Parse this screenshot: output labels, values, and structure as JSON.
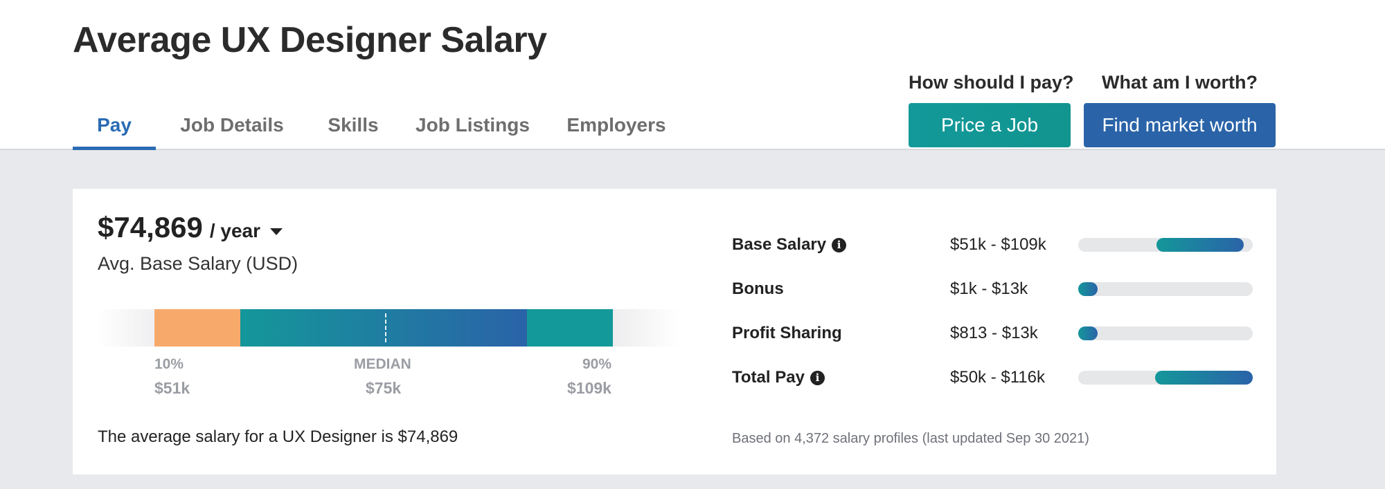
{
  "header": {
    "title": "Average UX Designer Salary",
    "tabs": [
      {
        "label": "Pay",
        "active": true
      },
      {
        "label": "Job Details",
        "active": false
      },
      {
        "label": "Skills",
        "active": false
      },
      {
        "label": "Job Listings",
        "active": false
      },
      {
        "label": "Employers",
        "active": false
      }
    ],
    "cta_employer": {
      "question": "How should I pay?",
      "button": "Price a Job",
      "color": "#14999a"
    },
    "cta_worker": {
      "question": "What am I worth?",
      "button": "Find market worth",
      "color": "#2a63a8"
    }
  },
  "salary": {
    "amount": "$74,869",
    "period": "/ year",
    "label": "Avg. Base Salary (USD)",
    "distribution": {
      "low_label": "10%",
      "low_value": "$51k",
      "median_label": "MEDIAN",
      "median_value": "$75k",
      "high_label": "90%",
      "high_value": "$109k"
    },
    "summary": "The average salary for a UX Designer is $74,869"
  },
  "pay_breakdown": [
    {
      "label": "Base Salary",
      "info": true,
      "range": "$51k - $109k",
      "fill_start": 0.45,
      "fill_end": 0.95
    },
    {
      "label": "Bonus",
      "info": false,
      "range": "$1k - $13k",
      "fill_start": 0.0,
      "fill_end": 0.11
    },
    {
      "label": "Profit Sharing",
      "info": false,
      "range": "$813 - $13k",
      "fill_start": 0.0,
      "fill_end": 0.11
    },
    {
      "label": "Total Pay",
      "info": true,
      "range": "$50k - $116k",
      "fill_start": 0.44,
      "fill_end": 1.0
    }
  ],
  "footnote": "Based on 4,372 salary profiles (last updated Sep 30 2021)",
  "icons": {
    "info": "info-icon",
    "dropdown": "caret-down-icon"
  }
}
